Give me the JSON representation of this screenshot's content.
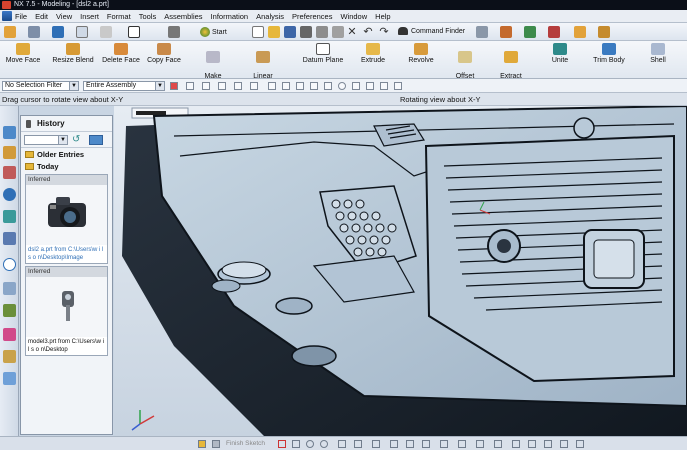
{
  "window": {
    "title": "NX 7.5 - Modeling - [dsl2 a.prt]"
  },
  "menu": [
    "File",
    "Edit",
    "View",
    "Insert",
    "Format",
    "Tools",
    "Assemblies",
    "Information",
    "Analysis",
    "Preferences",
    "Window",
    "Help"
  ],
  "toolbar": {
    "start_label": "Start",
    "command_finder_label": "Command Finder"
  },
  "ribbon": [
    {
      "label": "Move Face",
      "icon": "move-face-icon"
    },
    {
      "label": "Resize Blend",
      "icon": "resize-blend-icon"
    },
    {
      "label": "Delete Face",
      "icon": "delete-face-icon"
    },
    {
      "label": "Copy Face",
      "icon": "copy-face-icon"
    },
    {
      "label": "Make\nCoplanar",
      "icon": "make-coplanar-icon"
    },
    {
      "label": "Linear\nDimension",
      "icon": "linear-dimension-icon"
    },
    {
      "label": "Datum Plane",
      "icon": "datum-plane-icon"
    },
    {
      "label": "Extrude",
      "icon": "extrude-icon"
    },
    {
      "label": "Revolve",
      "icon": "revolve-icon"
    },
    {
      "label": "Offset\nEmboss",
      "icon": "offset-emboss-icon"
    },
    {
      "label": "Extract\nBody",
      "icon": "extract-body-icon"
    },
    {
      "label": "Unite",
      "icon": "unite-icon"
    },
    {
      "label": "Trim Body",
      "icon": "trim-body-icon"
    },
    {
      "label": "Shell",
      "icon": "shell-icon"
    }
  ],
  "selection": {
    "filter_value": "No Selection Filter",
    "scope_value": "Entire Assembly"
  },
  "status": {
    "prompt": "Drag cursor to rotate view about X-Y",
    "status": "Rotating view about X-Y"
  },
  "history": {
    "title": "History",
    "groups": {
      "older": "Older Entries",
      "today": "Today"
    },
    "entries": [
      {
        "tag": "Inferred",
        "caption": "dsl2 a.prt from C:\\Users\\w i l s o n\\Desktop\\Image"
      },
      {
        "tag": "Inferred",
        "caption": "model3.prt from C:\\Users\\w i l s o n\\Desktop"
      }
    ]
  },
  "bottom": {
    "sketch_label": "Finish Sketch"
  },
  "colors": {
    "accent": "#2f6fb6",
    "model": "#b9cbd9",
    "edge": "#0e141b"
  }
}
